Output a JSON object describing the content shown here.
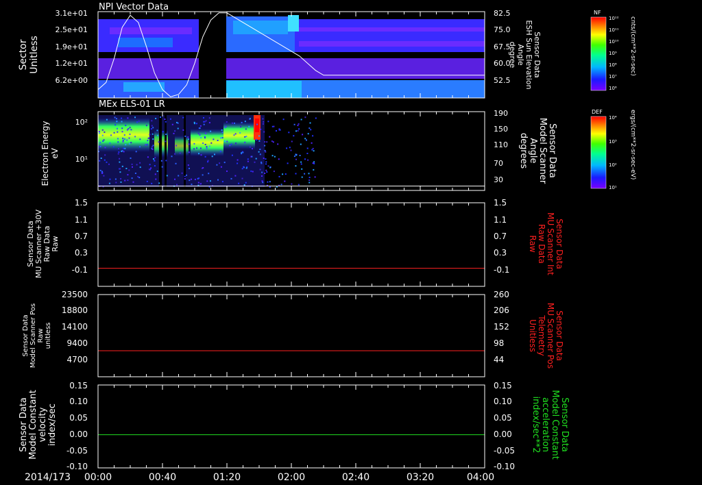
{
  "figure": {
    "date_label": "2014/173",
    "x_ticks": [
      "00:00",
      "00:40",
      "01:20",
      "02:00",
      "02:40",
      "03:20",
      "04:00"
    ],
    "x_range_minutes": [
      0,
      240
    ]
  },
  "colors": {
    "background": "#000000",
    "axis": "#ffffff",
    "red_axis": "#ff2020",
    "green_axis": "#20e020"
  },
  "chart_data": [
    {
      "type": "heatmap",
      "title": "NPI Vector Data",
      "ylabel": [
        "Sector",
        "Unitless"
      ],
      "yticks": [
        "3.1e+01",
        "2.5e+01",
        "1.9e+01",
        "1.2e+01",
        "6.2e+00"
      ],
      "right_axis": {
        "label": [
          "Sensor Data",
          "ESH Sun Elevation",
          "Angle",
          "degree"
        ],
        "ticks": [
          "82.5",
          "75.0",
          "67.5",
          "60.0",
          "52.5"
        ],
        "range": [
          46.5,
          82.5
        ]
      },
      "colorbar": {
        "title": "NF",
        "label": "cnts/(cm**2-sr-sec)",
        "ticks": [
          "10¹²",
          "10¹¹",
          "10¹⁰",
          "10⁹",
          "10⁸",
          "10⁷",
          "10⁶"
        ]
      },
      "overlay_line": {
        "name": "ESH Sun Elevation",
        "x": [
          0,
          5,
          10,
          15,
          20,
          25,
          30,
          35,
          40,
          45,
          50,
          55,
          60,
          65,
          70,
          75,
          80,
          85,
          90,
          95,
          100,
          105,
          110,
          115,
          120,
          125,
          130,
          135,
          140,
          145,
          150,
          155,
          240
        ],
        "y": [
          50,
          53,
          63,
          76,
          81,
          78,
          68,
          57,
          50,
          47,
          48,
          52,
          61,
          72,
          79,
          82,
          82,
          80,
          78,
          76,
          74,
          72,
          70,
          68,
          66,
          64,
          61,
          58,
          56,
          56,
          56,
          56,
          56
        ]
      },
      "gap_minutes": [
        60,
        79
      ]
    },
    {
      "type": "heatmap",
      "title": "MEx ELS-01 LR",
      "ylabel": [
        "Electron Energy",
        "eV"
      ],
      "yticks": [
        "10²",
        "10¹"
      ],
      "right_axis": {
        "label": [
          "Sensor Data",
          "Model Scanner",
          "Angle",
          "degrees"
        ],
        "ticks": [
          "190",
          "150",
          "110",
          "70",
          "30"
        ],
        "range": [
          10,
          190
        ]
      },
      "colorbar": {
        "title": "DEF",
        "label": "ergs/(cm**2-sr-sec-eV)",
        "ticks": [
          "10⁴",
          "10³",
          "10²",
          "10¹"
        ]
      },
      "data_end_minutes": 135,
      "overlay_value_degrees": 20
    },
    {
      "type": "line",
      "ylabel": [
        "Sensor Data",
        "MU Scanner +30V",
        "Raw Data",
        "Raw"
      ],
      "yticks": [
        "1.5",
        "1.1",
        "0.7",
        "0.3",
        "-0.1"
      ],
      "ylim": [
        -0.35,
        1.5
      ],
      "right_axis": {
        "label": [
          "Sensor Data",
          "MU Scanner Int",
          "Raw Data",
          "Raw"
        ],
        "ticks": [
          "1.5",
          "1.1",
          "0.7",
          "0.3",
          "-0.1"
        ],
        "color": "red"
      },
      "series": [
        {
          "x": [
            0,
            240
          ],
          "y": [
            0.05,
            0.05
          ],
          "color": "#ff2020"
        }
      ]
    },
    {
      "type": "line",
      "ylabel": [
        "Sensor Data",
        "Model Scanner Pos",
        "Raw",
        "unitless"
      ],
      "yticks": [
        "23500",
        "18800",
        "14100",
        "9400",
        "4700"
      ],
      "ylim": [
        0,
        23500
      ],
      "right_axis": {
        "label": [
          "Sensor Data",
          "MU Scanner Pos",
          "Telemetry",
          "Unitless"
        ],
        "ticks": [
          "260",
          "206",
          "152",
          "98",
          "44"
        ],
        "range": [
          0,
          260
        ],
        "color": "red"
      },
      "series": [
        {
          "x": [
            0,
            240
          ],
          "y": [
            7450,
            7450
          ],
          "color": "#ff2020"
        }
      ]
    },
    {
      "type": "line",
      "ylabel": [
        "Sensor Data",
        "Model Constant",
        "velocity",
        "index/sec"
      ],
      "yticks": [
        "0.15",
        "0.10",
        "0.05",
        "0.00",
        "-0.05",
        "-0.10"
      ],
      "ylim": [
        -0.1,
        0.15
      ],
      "right_axis": {
        "label": [
          "Sensor Data",
          "Model Constant",
          "acceleration",
          "index/sec**2"
        ],
        "ticks": [
          "0.15",
          "0.10",
          "0.05",
          "0.00",
          "-0.05",
          "-0.10"
        ],
        "color": "green"
      },
      "series": [
        {
          "x": [
            0,
            240
          ],
          "y": [
            0.0,
            0.0
          ],
          "color": "#20e020"
        }
      ]
    }
  ]
}
